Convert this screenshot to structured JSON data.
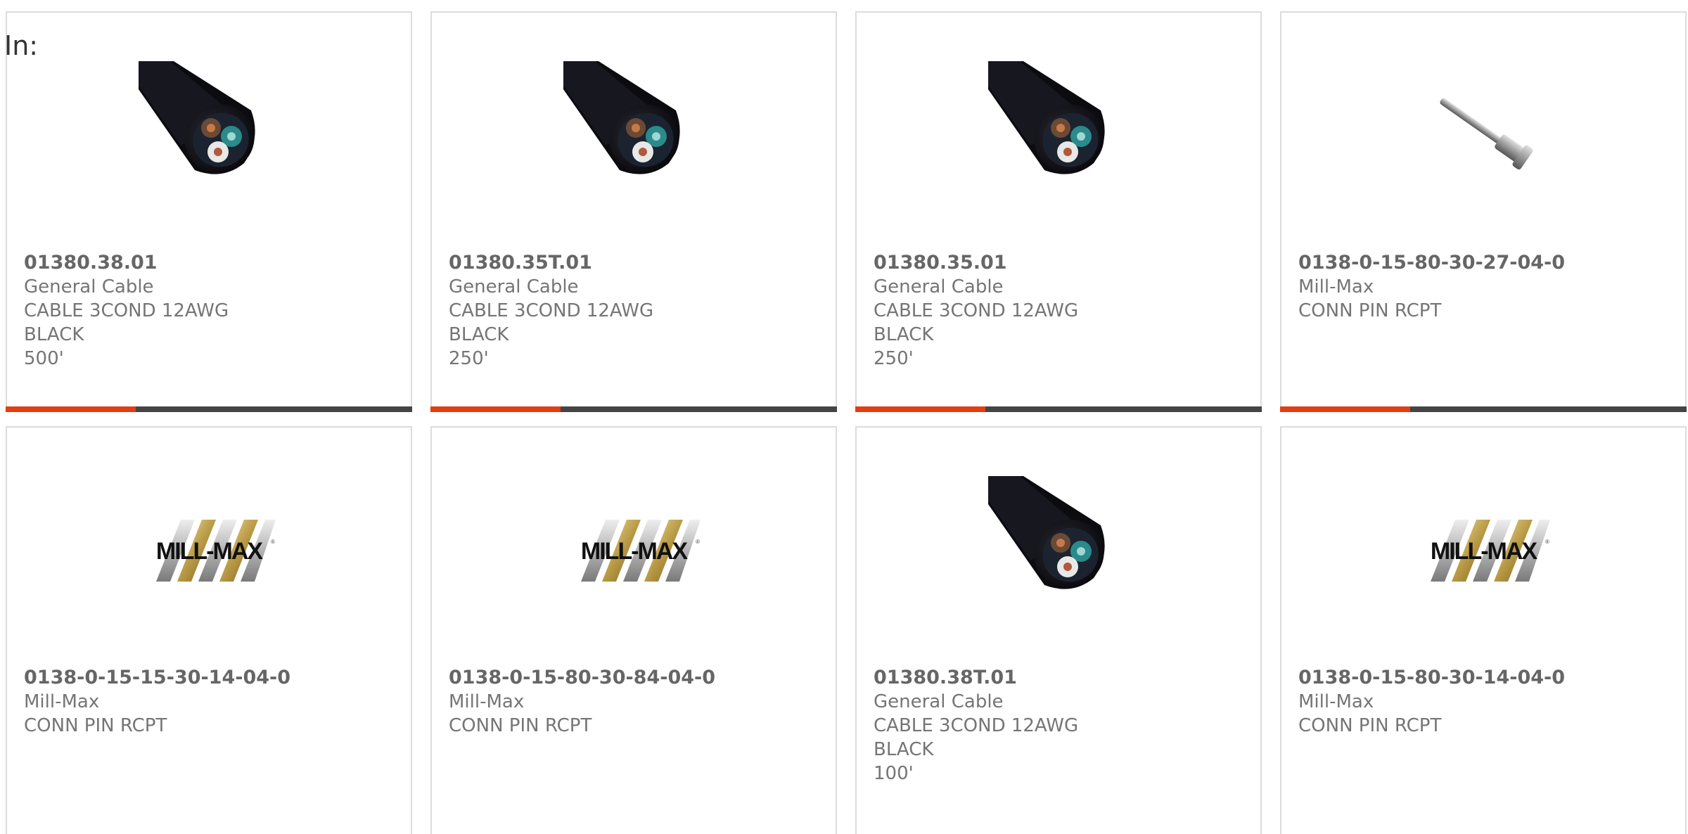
{
  "page": {
    "label": "In:",
    "accent_color": "#e43d12",
    "track_color": "#444444"
  },
  "products": [
    {
      "part_number": "01380.38.01",
      "manufacturer": "General Cable",
      "description": "CABLE 3COND 12AWG BLACK\n500'",
      "image": "black-cable-cross-section",
      "progress": 0.32
    },
    {
      "part_number": "01380.35T.01",
      "manufacturer": "General Cable",
      "description": "CABLE 3COND 12AWG BLACK\n250'",
      "image": "black-cable-cross-section",
      "progress": 0.32
    },
    {
      "part_number": "01380.35.01",
      "manufacturer": "General Cable",
      "description": "CABLE 3COND 12AWG BLACK\n250'",
      "image": "black-cable-cross-section",
      "progress": 0.32
    },
    {
      "part_number": "0138-0-15-80-30-27-04-0",
      "manufacturer": "Mill-Max",
      "description": "CONN PIN RCPT",
      "image": "connector-pin",
      "progress": 0.32
    },
    {
      "part_number": "0138-0-15-15-30-14-04-0",
      "manufacturer": "Mill-Max",
      "description": "CONN PIN RCPT",
      "image": "mill-max-logo"
    },
    {
      "part_number": "0138-0-15-80-30-84-04-0",
      "manufacturer": "Mill-Max",
      "description": "CONN PIN RCPT",
      "image": "mill-max-logo"
    },
    {
      "part_number": "01380.38T.01",
      "manufacturer": "General Cable",
      "description": "CABLE 3COND 12AWG BLACK\n100'",
      "image": "black-cable-cross-section"
    },
    {
      "part_number": "0138-0-15-80-30-14-04-0",
      "manufacturer": "Mill-Max",
      "description": "CONN PIN RCPT",
      "image": "mill-max-logo"
    }
  ]
}
